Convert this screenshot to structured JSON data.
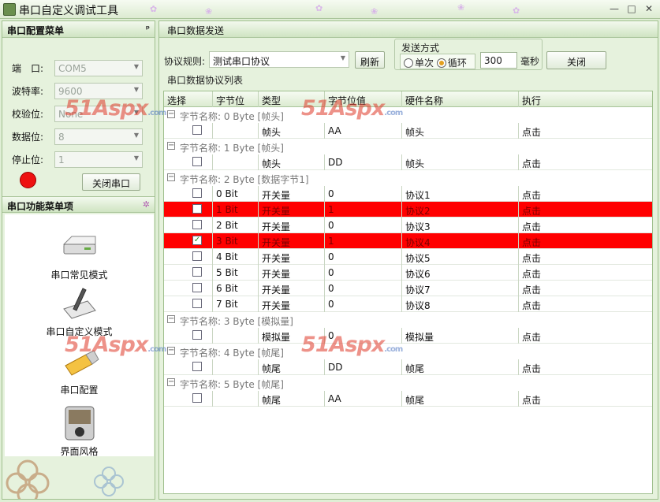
{
  "window": {
    "title": "串口自定义调试工具",
    "min": "—",
    "max": "□",
    "close": "✕"
  },
  "left": {
    "config_title": "串口配置菜单",
    "pin": "ᵖ",
    "fields": [
      {
        "label": "端　口:",
        "value": "COM5"
      },
      {
        "label": "波特率:",
        "value": "9600"
      },
      {
        "label": "校验位:",
        "value": "None"
      },
      {
        "label": "数据位:",
        "value": "8"
      },
      {
        "label": "停止位:",
        "value": "1"
      }
    ],
    "status_color": "#ee1111",
    "close_port": "关闭串口",
    "func_title": "串口功能菜单项",
    "func_icon": "✲",
    "menu": [
      {
        "label": "串口常见模式",
        "icon": "drive-icon"
      },
      {
        "label": "串口自定义模式",
        "icon": "tablet-pen-icon"
      },
      {
        "label": "串口配置",
        "icon": "usb-icon"
      },
      {
        "label": "界面风格",
        "icon": "media-player-icon"
      }
    ]
  },
  "right": {
    "title": "串口数据发送",
    "protocol_label": "协议规则:",
    "protocol_value": "测试串口协议",
    "refresh": "刷新",
    "send_mode_title": "发送方式",
    "mode_single": "单次",
    "mode_loop": "循环",
    "selected_mode": "循环",
    "interval": "300",
    "interval_unit": "毫秒",
    "close": "关闭",
    "list_title": "串口数据协议列表"
  },
  "columns": [
    "选择",
    "字节位",
    "类型",
    "字节位值",
    "硬件名称",
    "执行"
  ],
  "groups": [
    {
      "label": "字节名称: 0 Byte  [帧头]",
      "rows": [
        {
          "checked": false,
          "bit": "",
          "type": "帧头",
          "value": "AA",
          "name": "帧头",
          "exec": "点击",
          "hl": false
        }
      ]
    },
    {
      "label": "字节名称: 1 Byte  [帧头]",
      "rows": [
        {
          "checked": false,
          "bit": "",
          "type": "帧头",
          "value": "DD",
          "name": "帧头",
          "exec": "点击",
          "hl": false
        }
      ]
    },
    {
      "label": "字节名称: 2 Byte  [数据字节1]",
      "rows": [
        {
          "checked": false,
          "bit": "0 Bit",
          "type": "开关量",
          "value": "0",
          "name": "协议1",
          "exec": "点击",
          "hl": false
        },
        {
          "checked": false,
          "bit": "1 Bit",
          "type": "开关量",
          "value": "1",
          "name": "协议2",
          "exec": "点击",
          "hl": true
        },
        {
          "checked": false,
          "bit": "2 Bit",
          "type": "开关量",
          "value": "0",
          "name": "协议3",
          "exec": "点击",
          "hl": false
        },
        {
          "checked": true,
          "bit": "3 Bit",
          "type": "开关量",
          "value": "1",
          "name": "协议4",
          "exec": "点击",
          "hl": true
        },
        {
          "checked": false,
          "bit": "4 Bit",
          "type": "开关量",
          "value": "0",
          "name": "协议5",
          "exec": "点击",
          "hl": false
        },
        {
          "checked": false,
          "bit": "5 Bit",
          "type": "开关量",
          "value": "0",
          "name": "协议6",
          "exec": "点击",
          "hl": false
        },
        {
          "checked": false,
          "bit": "6 Bit",
          "type": "开关量",
          "value": "0",
          "name": "协议7",
          "exec": "点击",
          "hl": false
        },
        {
          "checked": false,
          "bit": "7 Bit",
          "type": "开关量",
          "value": "0",
          "name": "协议8",
          "exec": "点击",
          "hl": false
        }
      ]
    },
    {
      "label": "字节名称: 3 Byte  [模拟量]",
      "rows": [
        {
          "checked": false,
          "bit": "",
          "type": "模拟量",
          "value": "0",
          "name": "模拟量",
          "exec": "点击",
          "hl": false
        }
      ]
    },
    {
      "label": "字节名称: 4 Byte  [帧尾]",
      "rows": [
        {
          "checked": false,
          "bit": "",
          "type": "帧尾",
          "value": "DD",
          "name": "帧尾",
          "exec": "点击",
          "hl": false
        }
      ]
    },
    {
      "label": "字节名称: 5 Byte  [帧尾]",
      "rows": [
        {
          "checked": false,
          "bit": "",
          "type": "帧尾",
          "value": "AA",
          "name": "帧尾",
          "exec": "点击",
          "hl": false
        }
      ]
    }
  ],
  "watermark": {
    "text": "51Aspx",
    "suffix": ".com"
  },
  "colors": {
    "highlight": "#ff0000",
    "panel": "#e6f2dd"
  }
}
